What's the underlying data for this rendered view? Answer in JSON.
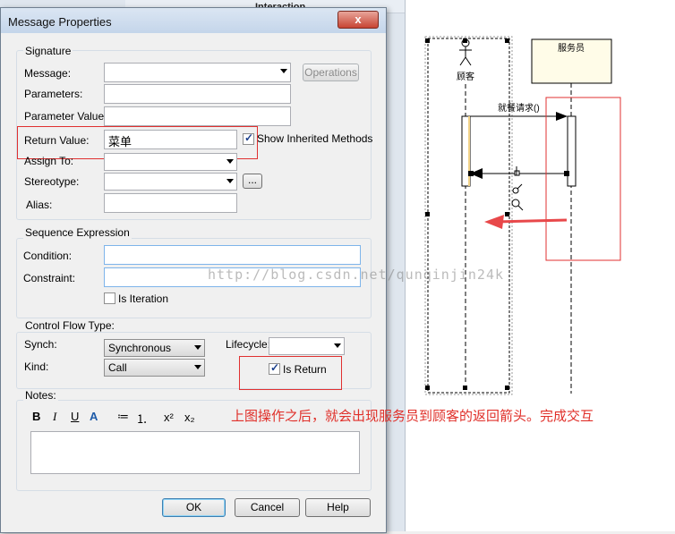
{
  "background": {
    "panel_title": "Interaction"
  },
  "dialog": {
    "title": "Message Properties",
    "close_glyph": "x",
    "signature": {
      "group_label": "Signature",
      "message_label": "Message:",
      "message_value": "",
      "operations_button": "Operations",
      "parameters_label": "Parameters:",
      "parameter_values_label": "Parameter Values:",
      "return_value_label": "Return Value:",
      "return_value": "菜单",
      "show_inherited_label": "Show Inherited Methods",
      "show_inherited_checked": true,
      "assign_to_label": "Assign To:",
      "stereotype_label": "Stereotype:",
      "stereotype_button": "...",
      "alias_label": "Alias:"
    },
    "sequence": {
      "group_label": "Sequence Expression",
      "condition_label": "Condition:",
      "constraint_label": "Constraint:",
      "is_iteration_label": "Is Iteration",
      "is_iteration_checked": false
    },
    "control_flow": {
      "group_label": "Control Flow Type:",
      "synch_label": "Synch:",
      "synch_value": "Synchronous",
      "lifecycle_label": "Lifecycle:",
      "lifecycle_value": "",
      "kind_label": "Kind:",
      "kind_value": "Call",
      "is_return_label": "Is Return",
      "is_return_checked": true
    },
    "notes": {
      "group_label": "Notes:",
      "toolbar": [
        "B",
        "I",
        "U",
        "A",
        "≔",
        "⒈",
        "x²",
        "x₂"
      ]
    },
    "buttons": {
      "ok": "OK",
      "cancel": "Cancel",
      "help": "Help"
    }
  },
  "diagram": {
    "actor_label": "顾客",
    "object_label": "服务员",
    "message_label": "就餐请求()"
  },
  "watermark": "http://blog.csdn.net/qunqinjin24k",
  "annotation": "上图操作之后，就会出现服务员到顾客的返回箭头。完成交互"
}
